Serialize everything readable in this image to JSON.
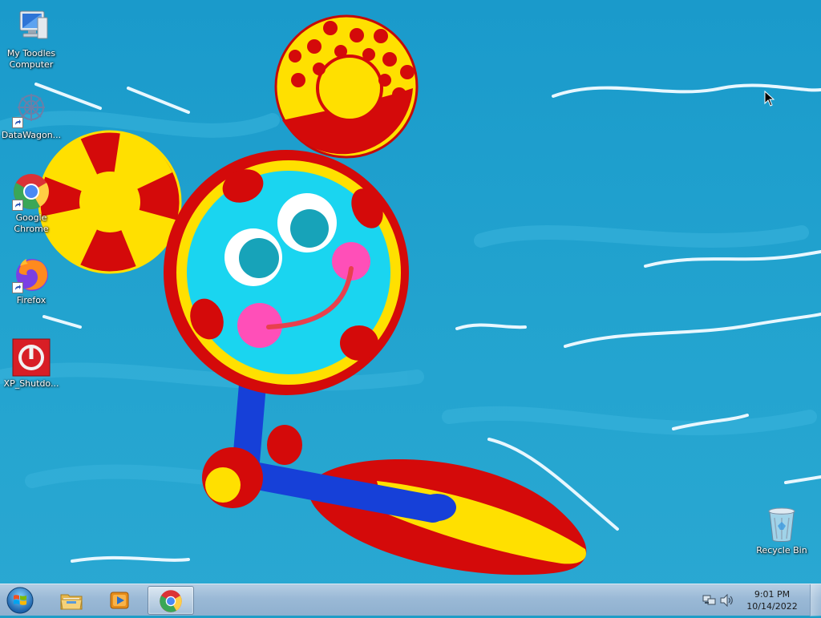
{
  "desktop": {
    "icons": [
      {
        "label": "My Toodles Computer",
        "icon": "computer-icon"
      },
      {
        "label": "DataWagon...",
        "icon": "datawagon-icon"
      },
      {
        "label": "Google Chrome",
        "icon": "chrome-icon"
      },
      {
        "label": "Firefox",
        "icon": "firefox-icon"
      },
      {
        "label": "XP_Shutdo...",
        "icon": "power-icon"
      }
    ],
    "recycle_bin": {
      "label": "Recycle Bin",
      "icon": "recycle-bin-icon"
    }
  },
  "taskbar": {
    "start_icon": "windows-logo-icon",
    "pinned": [
      {
        "name": "file-explorer",
        "icon": "folder-icon"
      },
      {
        "name": "media-player",
        "icon": "media-player-icon"
      },
      {
        "name": "google-chrome",
        "icon": "chrome-icon",
        "active": true
      }
    ],
    "tray": {
      "network_icon": "network-icon",
      "volume_icon": "volume-icon",
      "time": "9:01 PM",
      "date": "10/14/2022"
    }
  },
  "colors": {
    "sea": "#1f9dc7",
    "wave": "#e8f7ff",
    "red": "#d40a0a",
    "yellow": "#ffe000",
    "face": "#1ad5f0",
    "blue": "#1640d8",
    "pink": "#ff4fb8"
  }
}
